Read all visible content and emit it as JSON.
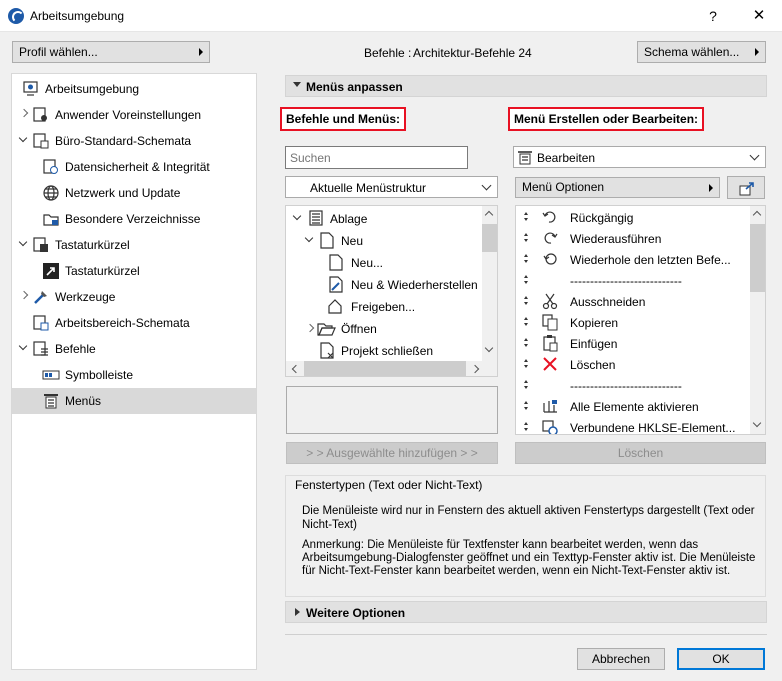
{
  "window": {
    "title": "Arbeitsumgebung",
    "help": "?",
    "close": "✕"
  },
  "top": {
    "profile_button": "Profil wählen...",
    "commands_label": "Befehle :",
    "commands_value": "Architektur-Befehle 24",
    "scheme_button": "Schema wählen..."
  },
  "sidebar": {
    "items": [
      {
        "label": "Arbeitsumgebung",
        "icon": "workspace-icon"
      },
      {
        "label": "Anwender Voreinstellungen",
        "icon": "user-settings-icon"
      },
      {
        "label": "Büro-Standard-Schemata",
        "icon": "office-schemes-icon"
      },
      {
        "label": "Datensicherheit & Integrität",
        "icon": "data-safety-icon"
      },
      {
        "label": "Netzwerk und Update",
        "icon": "globe-icon"
      },
      {
        "label": "Besondere Verzeichnisse",
        "icon": "folder-icon"
      },
      {
        "label": "Tastaturkürzel",
        "icon": "keyboard-shortcuts-icon"
      },
      {
        "label": "Tastaturkürzel",
        "icon": "shortcut-arrow-icon"
      },
      {
        "label": "Werkzeuge",
        "icon": "tools-icon"
      },
      {
        "label": "Arbeitsbereich-Schemata",
        "icon": "workspace-scheme-icon"
      },
      {
        "label": "Befehle",
        "icon": "commands-icon"
      },
      {
        "label": "Symbolleiste",
        "icon": "toolbar-icon"
      },
      {
        "label": "Menüs",
        "icon": "menus-icon"
      }
    ]
  },
  "main": {
    "section_title": "Menüs anpassen",
    "left_heading": "Befehle und Menüs:",
    "right_heading": "Menü Erstellen oder Bearbeiten:",
    "search_placeholder": "Suchen",
    "structure_select": "Aktuelle Menüstruktur",
    "tree": [
      {
        "label": "Ablage"
      },
      {
        "label": "Neu"
      },
      {
        "label": "Neu..."
      },
      {
        "label": "Neu & Wiederherstellen"
      },
      {
        "label": "Freigeben..."
      },
      {
        "label": "Öffnen"
      },
      {
        "label": "Projekt schließen"
      }
    ],
    "add_button": "> > Ausgewählte hinzufügen > >",
    "menu_select": "Bearbeiten",
    "menu_options_button": "Menü Optionen",
    "menu_items": [
      {
        "label": "Rückgängig",
        "icon": "undo-icon"
      },
      {
        "label": "Wiederausführen",
        "icon": "redo-icon"
      },
      {
        "label": "Wiederhole den letzten Befe...",
        "icon": "repeat-icon"
      },
      {
        "label": "----------------------------",
        "icon": ""
      },
      {
        "label": "Ausschneiden",
        "icon": "scissors-icon"
      },
      {
        "label": "Kopieren",
        "icon": "copy-icon"
      },
      {
        "label": "Einfügen",
        "icon": "paste-icon"
      },
      {
        "label": "Löschen",
        "icon": "delete-x-icon"
      },
      {
        "label": "----------------------------",
        "icon": ""
      },
      {
        "label": "Alle Elemente aktivieren",
        "icon": "select-all-icon"
      },
      {
        "label": "Verbundene HKLSE-Element...",
        "icon": "mep-elements-icon"
      }
    ],
    "delete_button": "Löschen",
    "info_title": "Fenstertypen (Text oder Nicht-Text)",
    "info_text1": "Die Menüleiste wird nur in Fenstern des aktuell aktiven Fenstertyps dargestellt (Text oder Nicht-Text)",
    "info_text2": "Anmerkung: Die Menüleiste für Textfenster kann bearbeitet werden, wenn das Arbeitsumgebung-Dialogfenster geöffnet und ein Texttyp-Fenster aktiv ist. Die Menüleiste für Nicht-Text-Fenster kann bearbeitet werden, wenn ein Nicht-Text-Fenster aktiv ist.",
    "more_options": "Weitere Optionen"
  },
  "footer": {
    "cancel": "Abbrechen",
    "ok": "OK"
  },
  "colors": {
    "highlight_red": "#e81123",
    "ok_border": "#0078d7",
    "selection": "#d9d9d9"
  }
}
